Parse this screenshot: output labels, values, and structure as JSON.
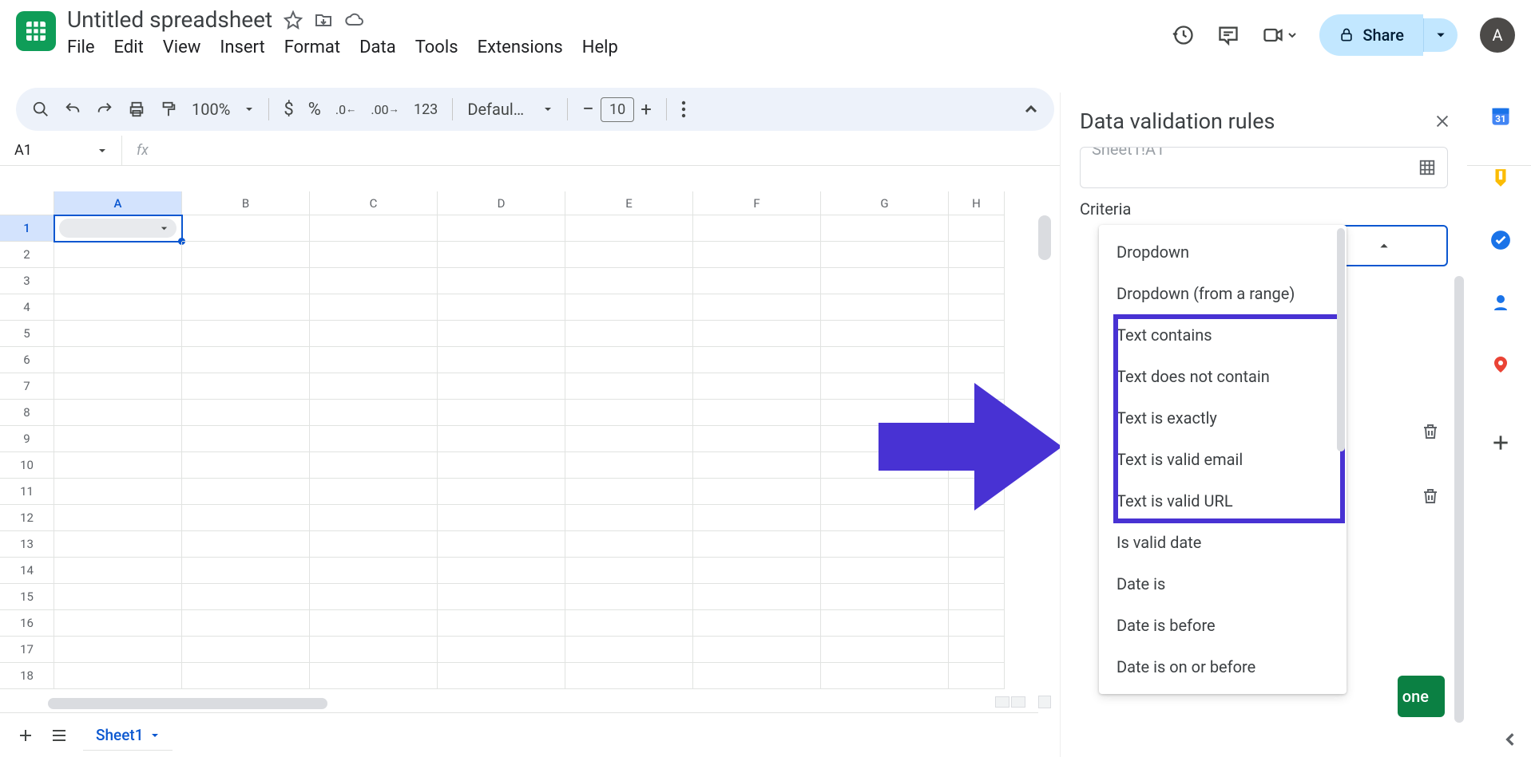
{
  "header": {
    "doc_title": "Untitled spreadsheet",
    "avatar_letter": "A",
    "share_label": "Share"
  },
  "menus": [
    "File",
    "Edit",
    "View",
    "Insert",
    "Format",
    "Data",
    "Tools",
    "Extensions",
    "Help"
  ],
  "toolbar": {
    "zoom": "100%",
    "font": "Defaul…",
    "font_size": "10"
  },
  "namebox": "A1",
  "columns": [
    "A",
    "B",
    "C",
    "D",
    "E",
    "F",
    "G",
    "H"
  ],
  "rows_visible": 18,
  "sidepanel": {
    "title": "Data validation rules",
    "range_partial": "Sheet1!A1",
    "criteria_label": "Criteria",
    "done_label": "one",
    "options": [
      "Dropdown",
      "Dropdown (from a range)",
      "Text contains",
      "Text does not contain",
      "Text is exactly",
      "Text is valid email",
      "Text is valid URL",
      "Is valid date",
      "Date is",
      "Date is before",
      "Date is on or before"
    ]
  },
  "sheet_tab": "Sheet1"
}
